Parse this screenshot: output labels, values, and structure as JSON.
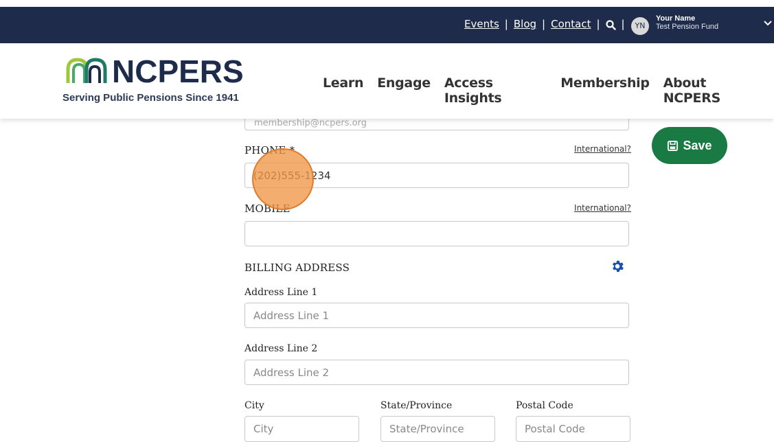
{
  "topbar": {
    "links": [
      "Events",
      "Blog",
      "Contact"
    ],
    "avatar_initials": "YN",
    "user_name": "Your Name",
    "user_org": "Test Pension Fund"
  },
  "header": {
    "logo_text": "NCPERS",
    "tagline": "Serving Public Pensions Since 1941",
    "nav": [
      "Learn",
      "Engage",
      "Access Insights",
      "Membership",
      "About NCPERS"
    ]
  },
  "form": {
    "email_value": "membership@ncpers.org",
    "phone_label": "PHONE *",
    "phone_value": "(202)555-1234",
    "phone_intl_link": "International?",
    "mobile_label": "MOBILE",
    "mobile_value": "",
    "mobile_intl_link": "International?",
    "billing_title": "BILLING ADDRESS",
    "address1_label": "Address Line 1",
    "address1_placeholder": "Address Line 1",
    "address2_label": "Address Line 2",
    "address2_placeholder": "Address Line 2",
    "city_label": "City",
    "city_placeholder": "City",
    "state_label": "State/Province",
    "state_placeholder": "State/Province",
    "postal_label": "Postal Code",
    "postal_placeholder": "Postal Code"
  },
  "save_label": "Save",
  "colors": {
    "topbar_bg": "#1e2b4a",
    "save_green": "#197a43",
    "gear_blue": "#1b4fa8",
    "click_marker": "#f0964680"
  }
}
